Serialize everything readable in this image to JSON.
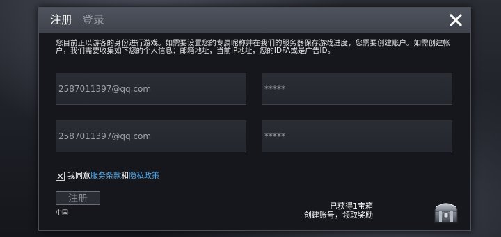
{
  "tabs": {
    "register": "注册",
    "login": "登录"
  },
  "notice": "您目前正以游客的身份进行游戏。如需要设置您的专属昵称并在我们的服务器保存游戏进度，您需要创建账户。如需创建帐户，我们需要收集如下您的个人信息：邮箱地址，当前IP地址，您的IDFA或是广告ID。",
  "form": {
    "email_1": "2587011397@qq.com",
    "password_1": "*****",
    "email_2": "2587011397@qq.com",
    "password_2": "*****"
  },
  "agreement": {
    "prefix": "我同意",
    "terms": "服务条款",
    "and": "和",
    "privacy": "隐私政策",
    "checked": true
  },
  "register_button": "注册",
  "region": "中国",
  "reward": {
    "line1": "已获得1宝箱",
    "line2": "创建账号，领取奖励"
  },
  "icons": {
    "close": "close-icon",
    "check": "check-icon",
    "chest": "treasure-chest-icon"
  },
  "colors": {
    "link": "#5aaef0",
    "header": "#4a4e58",
    "panel": "#15171c"
  }
}
